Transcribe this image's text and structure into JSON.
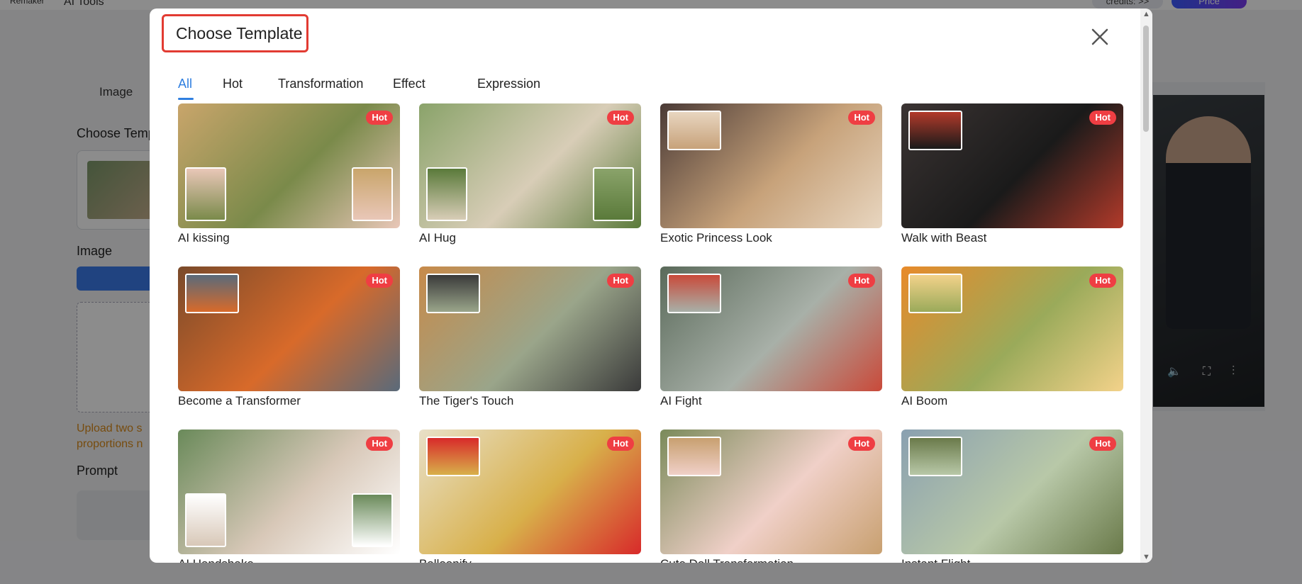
{
  "background": {
    "logo": "Remaker",
    "nav_ai_tools": "AI Tools",
    "credits": "credits: >>",
    "price": "Price",
    "tab_image": "Image",
    "choose_template": "Choose Temp",
    "image_label": "Image",
    "upload_warning": "Upload two s proportions n",
    "prompt_label": "Prompt"
  },
  "modal": {
    "title": "Choose Template",
    "tabs": [
      {
        "label": "All",
        "active": true
      },
      {
        "label": "Hot",
        "active": false
      },
      {
        "label": "Transformation",
        "active": false
      },
      {
        "label": "Effect",
        "active": false
      },
      {
        "label": "Expression",
        "active": false
      }
    ],
    "badge_text": "Hot",
    "templates": [
      {
        "label": "AI kissing",
        "colors": [
          "#c9a56b",
          "#7a8a4a",
          "#e9c7b8"
        ],
        "icon": "couple-kiss"
      },
      {
        "label": "AI Hug",
        "colors": [
          "#8aa36a",
          "#d8cdb7",
          "#5a7a3a"
        ],
        "icon": "hug"
      },
      {
        "label": "Exotic Princess Look",
        "colors": [
          "#4a3a36",
          "#c7a27a",
          "#e8d6c0"
        ],
        "icon": "princess"
      },
      {
        "label": "Walk with Beast",
        "colors": [
          "#3b3433",
          "#1a1a1a",
          "#b23a2a"
        ],
        "icon": "runway-lion"
      },
      {
        "label": "Become a Transformer",
        "colors": [
          "#7a4a2a",
          "#d86a2a",
          "#5a6a7a"
        ],
        "icon": "robot"
      },
      {
        "label": "The Tiger's Touch",
        "colors": [
          "#c78a4a",
          "#9aa58a",
          "#3a3a3a"
        ],
        "icon": "tiger"
      },
      {
        "label": "AI Fight",
        "colors": [
          "#5a6a5a",
          "#a8b0a8",
          "#c94a3a"
        ],
        "icon": "fight"
      },
      {
        "label": "AI Boom",
        "colors": [
          "#e88a2a",
          "#9aaa5a",
          "#f3d28a"
        ],
        "icon": "explosion"
      },
      {
        "label": "AI Handshake",
        "colors": [
          "#6a8a5a",
          "#d8c8b8",
          "#ffffff"
        ],
        "icon": "handshake"
      },
      {
        "label": "Balloonify",
        "colors": [
          "#e8e0c8",
          "#d8b04a",
          "#d82a2a"
        ],
        "icon": "balloon"
      },
      {
        "label": "Cute Doll Transformation",
        "colors": [
          "#7a8a5a",
          "#f0d0c8",
          "#c8a070"
        ],
        "icon": "doll"
      },
      {
        "label": "Instant Flight",
        "colors": [
          "#8aa0b0",
          "#b8c8a8",
          "#6a7a4a"
        ],
        "icon": "flight"
      }
    ]
  },
  "icons": {
    "close": "close-icon"
  }
}
